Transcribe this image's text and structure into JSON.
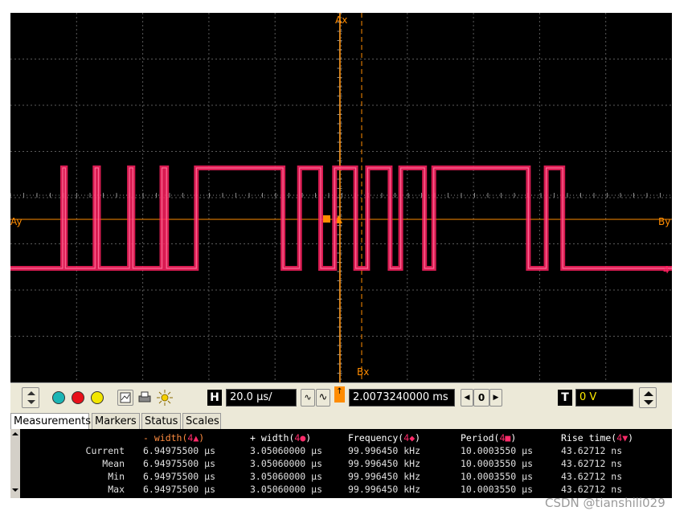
{
  "graticule": {
    "ax_label": "Ax",
    "bx_label": "Bx",
    "ay_label": "Ay",
    "by_label": "By",
    "channel_label": "4"
  },
  "colors": {
    "trace": "#ff2060",
    "marker": "#ff8c00",
    "grid": "#5a5a5a",
    "screen": "#000000"
  },
  "signal": {
    "high_to_low": [
      0.034,
      0.083,
      0.133,
      0.185,
      0.236,
      0.412,
      0.469,
      0.522,
      0.574,
      0.626,
      0.783,
      0.835,
      0.885
    ],
    "low_to_high": [
      0.079,
      0.128,
      0.18,
      0.229,
      0.281,
      0.437,
      0.49,
      0.54,
      0.59,
      0.64,
      0.693,
      0.755,
      0.81
    ]
  },
  "toolbar": {
    "horizontal_label": "H",
    "timebase": "20.0 µs/",
    "delay": "2.0073240000 ms",
    "nav_value": "0",
    "trigger_label": "T",
    "trigger_level": "0 V"
  },
  "tabs": [
    {
      "label": "Measurements"
    },
    {
      "label": "Markers"
    },
    {
      "label": "Status"
    },
    {
      "label": "Scales"
    }
  ],
  "measurements": {
    "headers": [
      {
        "pre": "- width(",
        "ch": "4",
        "sym": "▲",
        "post": ")"
      },
      {
        "pre": "+ width(",
        "ch": "4",
        "sym": "●",
        "post": ")"
      },
      {
        "pre": "Frequency(",
        "ch": "4",
        "sym": "◆",
        "post": ")"
      },
      {
        "pre": "Period(",
        "ch": "4",
        "sym": "■",
        "post": ")"
      },
      {
        "pre": "Rise time(",
        "ch": "4",
        "sym": "▼",
        "post": ")"
      }
    ],
    "rows": [
      {
        "label": "Current",
        "values": [
          "6.94975500 µs",
          "3.05060000 µs",
          "99.996450 kHz",
          "10.0003550 µs",
          "43.62712 ns"
        ]
      },
      {
        "label": "Mean",
        "values": [
          "6.94975500 µs",
          "3.05060000 µs",
          "99.996450 kHz",
          "10.0003550 µs",
          "43.62712 ns"
        ]
      },
      {
        "label": "Min",
        "values": [
          "6.94975500 µs",
          "3.05060000 µs",
          "99.996450 kHz",
          "10.0003550 µs",
          "43.62712 ns"
        ]
      },
      {
        "label": "Max",
        "values": [
          "6.94975500 µs",
          "3.05060000 µs",
          "99.996450 kHz",
          "10.0003550 µs",
          "43.62712 ns"
        ]
      }
    ]
  },
  "watermark": "CSDN @tianshili029"
}
